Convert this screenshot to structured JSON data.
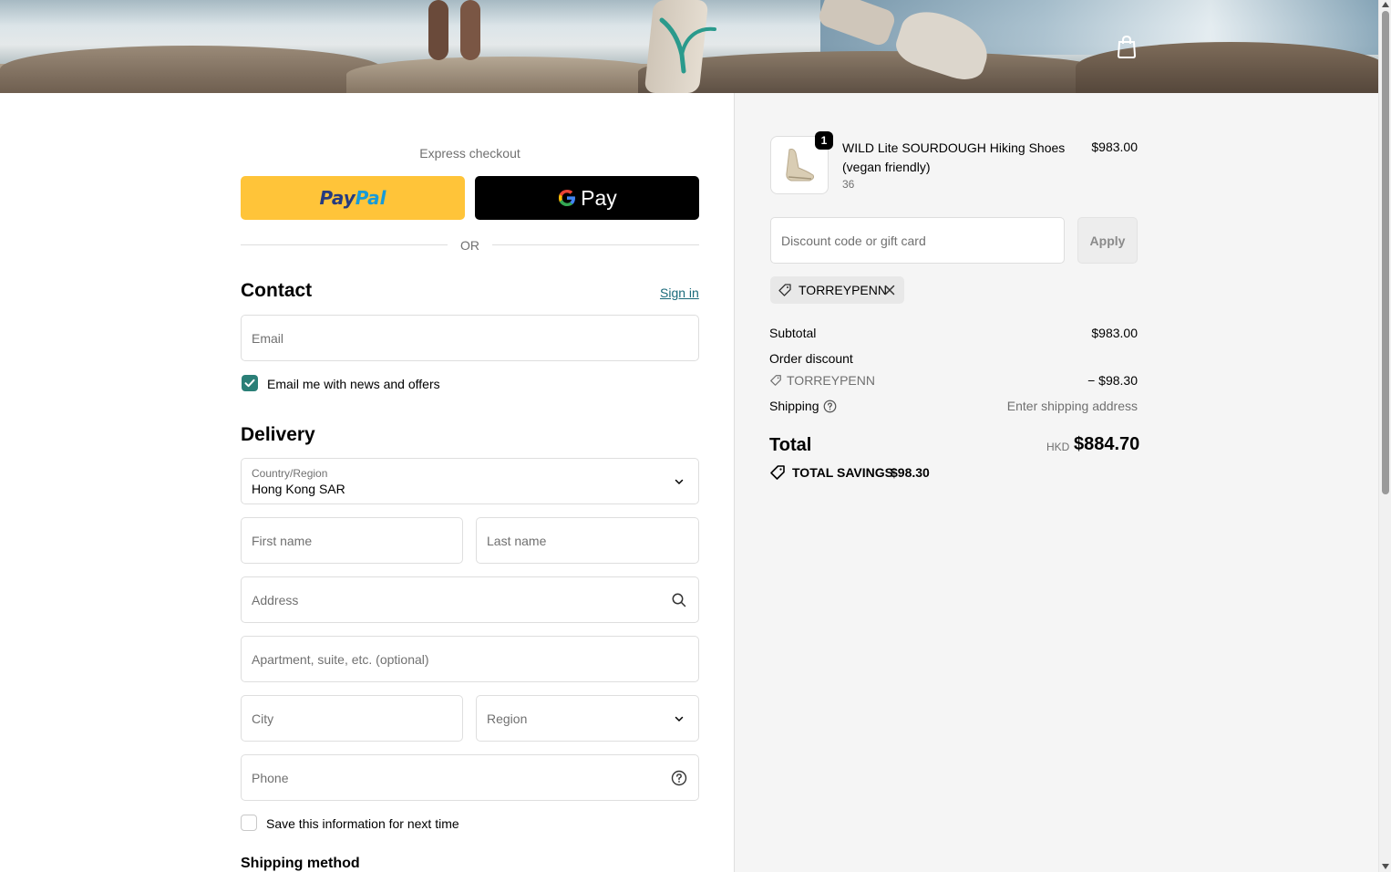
{
  "express": {
    "label": "Express checkout",
    "paypal_part1": "Pay",
    "paypal_part2": "Pal",
    "gpay_label": "Pay",
    "or_label": "OR"
  },
  "contact": {
    "heading": "Contact",
    "sign_in": "Sign in",
    "email_placeholder": "Email",
    "newsletter_label": "Email me with news and offers",
    "newsletter_checked": true
  },
  "delivery": {
    "heading": "Delivery",
    "country_label": "Country/Region",
    "country_value": "Hong Kong SAR",
    "first_name_placeholder": "First name",
    "last_name_placeholder": "Last name",
    "address_placeholder": "Address",
    "apartment_placeholder": "Apartment, suite, etc. (optional)",
    "city_placeholder": "City",
    "region_placeholder": "Region",
    "phone_placeholder": "Phone",
    "save_info_label": "Save this information for next time",
    "save_info_checked": false
  },
  "shipping_method_heading": "Shipping method",
  "order": {
    "product": {
      "name": "WILD Lite SOURDOUGH Hiking Shoes (vegan friendly)",
      "variant": "36",
      "price": "$983.00",
      "quantity": "1"
    },
    "discount_placeholder": "Discount code or gift card",
    "apply_label": "Apply",
    "applied_code": "TORREYPENN",
    "subtotal_label": "Subtotal",
    "subtotal_value": "$983.00",
    "order_discount_label": "Order discount",
    "discount_code": "TORREYPENN",
    "discount_value": "− $98.30",
    "shipping_label": "Shipping",
    "shipping_value": "Enter shipping address",
    "total_label": "Total",
    "total_currency": "HKD",
    "total_value": "$884.70",
    "savings_label": "TOTAL SAVINGS",
    "savings_value": "$98.30"
  },
  "colors": {
    "accent": "#2a7f77",
    "paypal_yellow": "#ffc439",
    "link": "#1a6a7a"
  },
  "icons": [
    "shopping-bag-icon",
    "chevron-down-icon",
    "search-icon",
    "help-circle-icon",
    "tag-icon",
    "close-icon",
    "check-icon",
    "google-g-icon"
  ]
}
